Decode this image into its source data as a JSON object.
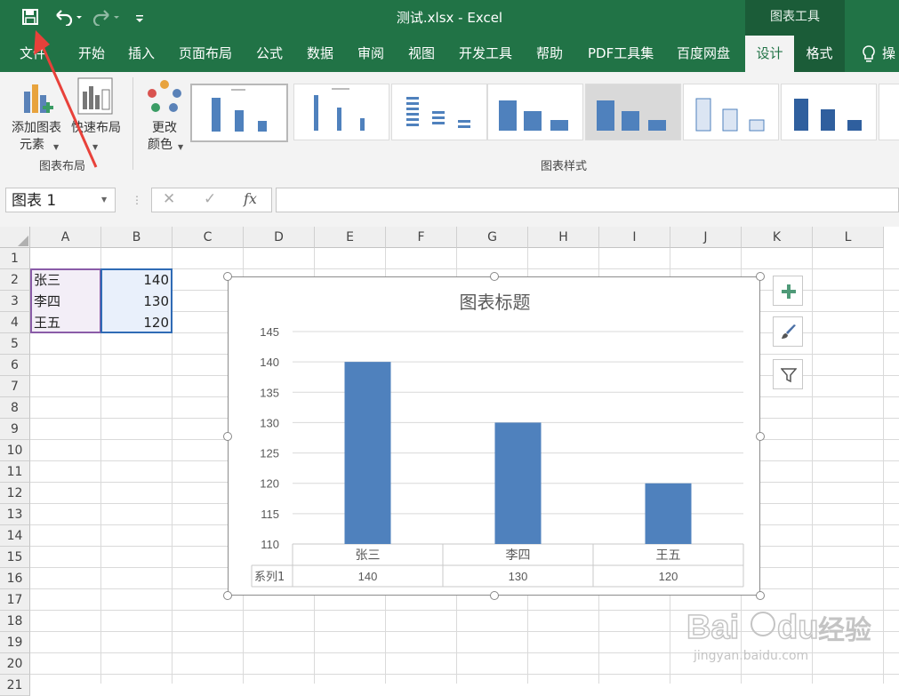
{
  "window": {
    "title": "测试.xlsx - Excel",
    "context_tab": "图表工具"
  },
  "tabs": [
    {
      "label": "文件"
    },
    {
      "label": "开始"
    },
    {
      "label": "插入"
    },
    {
      "label": "页面布局"
    },
    {
      "label": "公式"
    },
    {
      "label": "数据"
    },
    {
      "label": "审阅"
    },
    {
      "label": "视图"
    },
    {
      "label": "开发工具"
    },
    {
      "label": "帮助"
    },
    {
      "label": "PDF工具集"
    },
    {
      "label": "百度网盘"
    },
    {
      "label": "设计"
    },
    {
      "label": "格式"
    },
    {
      "label": "操"
    }
  ],
  "ribbon": {
    "add_element": {
      "line1": "添加图表",
      "line2": "元素"
    },
    "quick_layout": {
      "line1": "快速布局",
      "line2": ""
    },
    "change_colors": {
      "line1": "更改",
      "line2": "颜色"
    },
    "group_layout": "图表布局",
    "group_styles": "图表样式"
  },
  "formula_bar": {
    "name_box": "图表 1",
    "cancel": "✕",
    "enter": "✓",
    "fx": "fx",
    "value": ""
  },
  "grid": {
    "columns": [
      "A",
      "B",
      "C",
      "D",
      "E",
      "F",
      "G",
      "H",
      "I",
      "J",
      "K",
      "L"
    ],
    "rows": [
      "1",
      "2",
      "3",
      "4",
      "5",
      "6",
      "7",
      "8",
      "9",
      "10",
      "11",
      "12",
      "13",
      "14",
      "15",
      "16",
      "17",
      "18",
      "19",
      "20",
      "21"
    ],
    "data": [
      {
        "name": "张三",
        "value": "140"
      },
      {
        "name": "李四",
        "value": "130"
      },
      {
        "name": "王五",
        "value": "120"
      }
    ]
  },
  "chart_data": {
    "type": "bar",
    "title": "图表标题",
    "categories": [
      "张三",
      "李四",
      "王五"
    ],
    "series": [
      {
        "name": "系列1",
        "values": [
          140,
          130,
          120
        ]
      }
    ],
    "y_ticks": [
      "145",
      "140",
      "135",
      "130",
      "125",
      "120",
      "115",
      "110"
    ],
    "ylim": [
      110,
      145
    ],
    "table_values": [
      "140",
      "130",
      "120"
    ],
    "bar_color": "#4f81bd",
    "grid": true
  },
  "watermark": {
    "text": "Baidu经验",
    "sub": "jingyan.baidu.com"
  },
  "colors": {
    "excel_green": "#217346",
    "bar": "#4f81bd",
    "arrow": "#e8413a"
  }
}
